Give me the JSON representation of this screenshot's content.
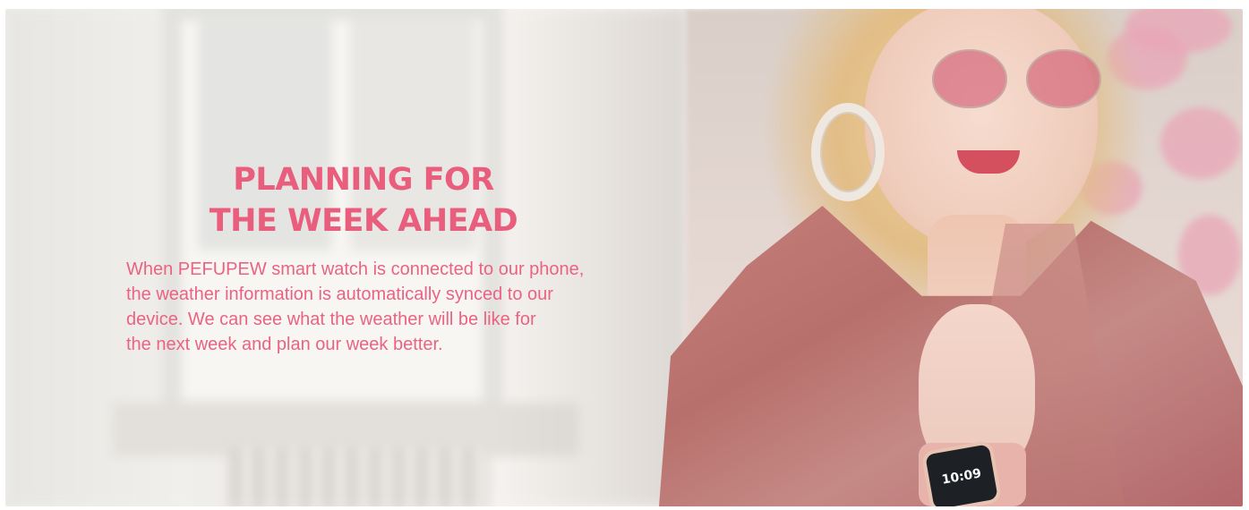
{
  "banner": {
    "headline_lines": [
      "PLANNING FOR",
      "THE WEEK AHEAD"
    ],
    "body_lines": [
      "When PEFUPEW smart watch is connected to our phone,",
      "the weather information is automatically synced to our",
      "device. We can see what the weather will be like for",
      "the next week and plan our week better."
    ],
    "watch_time": "10:09",
    "colors": {
      "headline": "#e85e7c",
      "body": "#ea6381"
    }
  }
}
